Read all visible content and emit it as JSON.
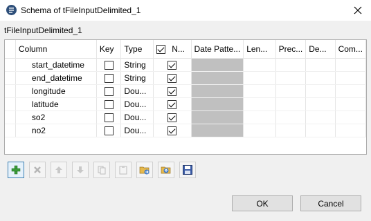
{
  "window": {
    "title": "Schema of tFileInputDelimited_1",
    "subtitle": "tFileInputDelimited_1"
  },
  "grid": {
    "columns": [
      "Column",
      "Key",
      "Type",
      "N...",
      "Date Patte...",
      "Len...",
      "Prec...",
      "De...",
      "Com..."
    ],
    "rows": [
      {
        "column": "start_datetime",
        "key": false,
        "type": "String",
        "nullable": true
      },
      {
        "column": "end_datetime",
        "key": false,
        "type": "String",
        "nullable": true
      },
      {
        "column": "longitude",
        "key": false,
        "type": "Dou...",
        "nullable": true
      },
      {
        "column": "latitude",
        "key": false,
        "type": "Dou...",
        "nullable": true
      },
      {
        "column": "so2",
        "key": false,
        "type": "Dou...",
        "nullable": true
      },
      {
        "column": "no2",
        "key": false,
        "type": "Dou...",
        "nullable": true
      }
    ]
  },
  "toolbar": {
    "buttons": [
      "add-icon",
      "delete-icon",
      "move-up-icon",
      "move-down-icon",
      "copy-icon",
      "paste-icon",
      "import-icon",
      "export-icon",
      "save-icon"
    ]
  },
  "buttons": {
    "ok": "OK",
    "cancel": "Cancel"
  }
}
